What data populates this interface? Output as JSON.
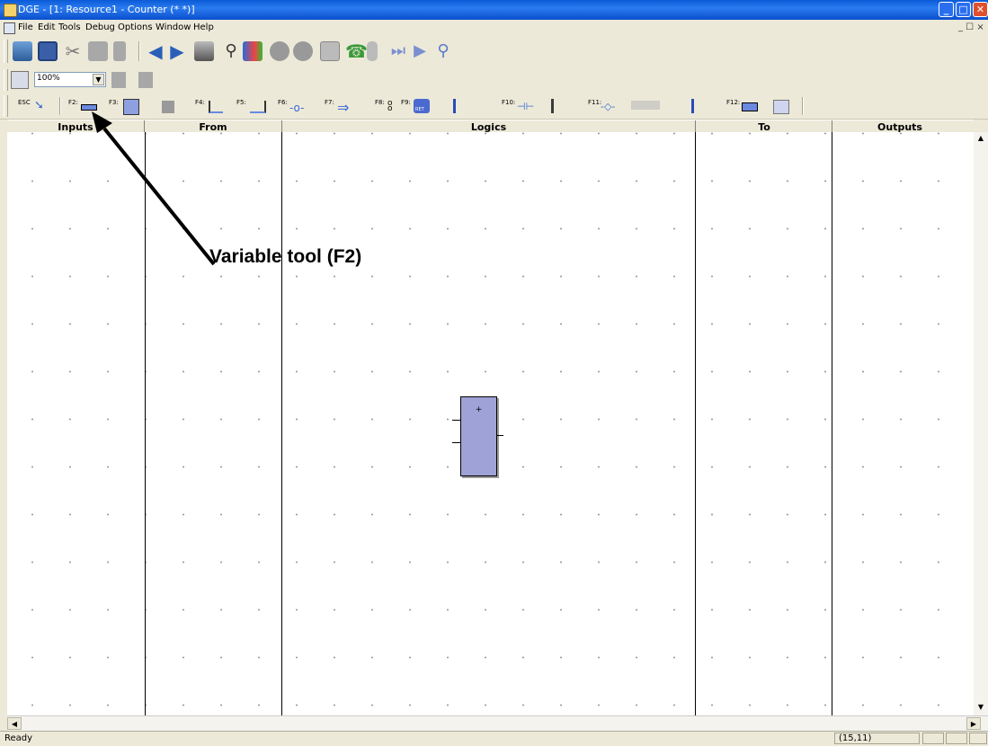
{
  "window": {
    "title": "DGE - [1: Resource1 - Counter (* *)]",
    "controls": [
      "minimize-icon",
      "maximize-icon",
      "close-icon"
    ]
  },
  "menu": {
    "items": [
      "File",
      "Edit",
      "Tools",
      "Debug",
      "Options",
      "Window",
      "Help"
    ],
    "mdi_controls": "_ ☐ ×"
  },
  "toolbar_main": {
    "icons": [
      "new-icon",
      "save-icon",
      "cut-icon",
      "copy-icon",
      "paste-icon",
      "undo-icon",
      "redo-icon",
      "print-icon",
      "find-icon",
      "library-icon",
      "stop-icon",
      "pause-icon",
      "monitor-icon",
      "connect-icon",
      "build-icon",
      "step-icon",
      "run-icon",
      "inspect-icon"
    ]
  },
  "toolbar_zoom": {
    "zoom_value": "100%"
  },
  "toolbar_tools": {
    "esc_key": "ESC",
    "f2_key": "F2:",
    "f3_key": "F3:",
    "f4_key": "F4:",
    "f5_key": "F5:",
    "f6_key": "F6:",
    "f7_key": "F7:",
    "f8_key": "F8:",
    "f9_key": "F9:",
    "f10_key": "F10:",
    "f11_key": "F11:",
    "f12_key": "F12:",
    "ret_label": "RET"
  },
  "columns": [
    {
      "label": "Inputs"
    },
    {
      "label": "From"
    },
    {
      "label": "Logics"
    },
    {
      "label": "To"
    },
    {
      "label": "Outputs"
    }
  ],
  "function_block": {
    "symbol": "+"
  },
  "annotation": {
    "label": "Variable tool (F2)"
  },
  "status": {
    "text": "Ready",
    "coords": "(15,11)"
  }
}
